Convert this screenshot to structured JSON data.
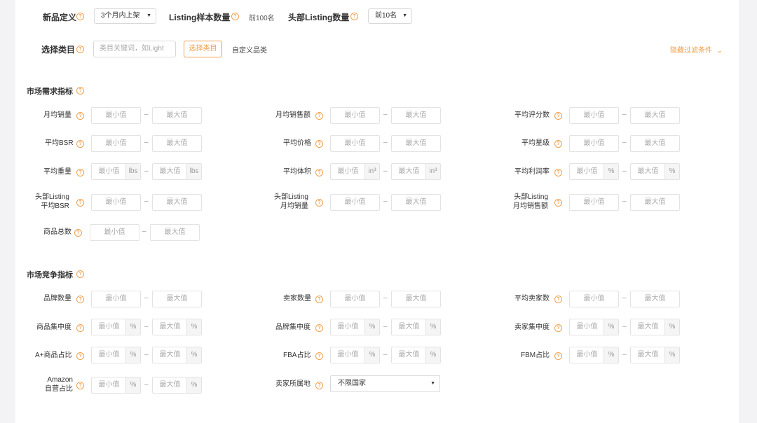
{
  "top": {
    "new_def_label": "新品定义",
    "new_def_value": "3个月内上架",
    "sample_label": "Listing样本数量",
    "sample_value": "前100名",
    "head_label": "头部Listing数量",
    "head_value": "前10名",
    "category_label": "选择类目",
    "category_placeholder": "类目关键词，如Light",
    "select_category_btn": "选择类目",
    "custom_category": "自定义品类",
    "hide_filter": "隐藏过滤条件"
  },
  "placeholders": {
    "min": "最小值",
    "max": "最大值"
  },
  "units": {
    "lbs": "lbs",
    "in3": "in³",
    "pct": "%"
  },
  "market_demand": {
    "title": "市场需求指标",
    "fields": {
      "monthly_sales": "月均销量",
      "monthly_revenue": "月均销售额",
      "avg_rating_count": "平均评分数",
      "avg_bsr": "平均BSR",
      "avg_price": "平均价格",
      "avg_stars": "平均星级",
      "avg_weight": "平均重量",
      "avg_volume": "平均体积",
      "avg_margin": "平均利润率",
      "head_bsr_1": "头部Listing",
      "head_bsr_2": "平均BSR",
      "head_sales_1": "头部Listing",
      "head_sales_2": "月均销量",
      "head_revenue_1": "头部Listing",
      "head_revenue_2": "月均销售额",
      "total_products": "商品总数"
    }
  },
  "market_competition": {
    "title": "市场竞争指标",
    "fields": {
      "brand_count": "品牌数量",
      "seller_count": "卖家数量",
      "avg_seller_count": "平均卖家数",
      "product_concentration": "商品集中度",
      "brand_concentration": "品牌集中度",
      "seller_concentration": "卖家集中度",
      "aplus_ratio": "A+商品占比",
      "fba_ratio": "FBA占比",
      "fbm_ratio": "FBM占比",
      "amazon_self_1": "Amazon",
      "amazon_self_2": "自营占比",
      "seller_location": "卖家所属地",
      "seller_location_value": "不限国家"
    }
  },
  "colors": {
    "accent": "#f0a04b",
    "background": "#f3f3f5",
    "panel": "#ffffff"
  }
}
